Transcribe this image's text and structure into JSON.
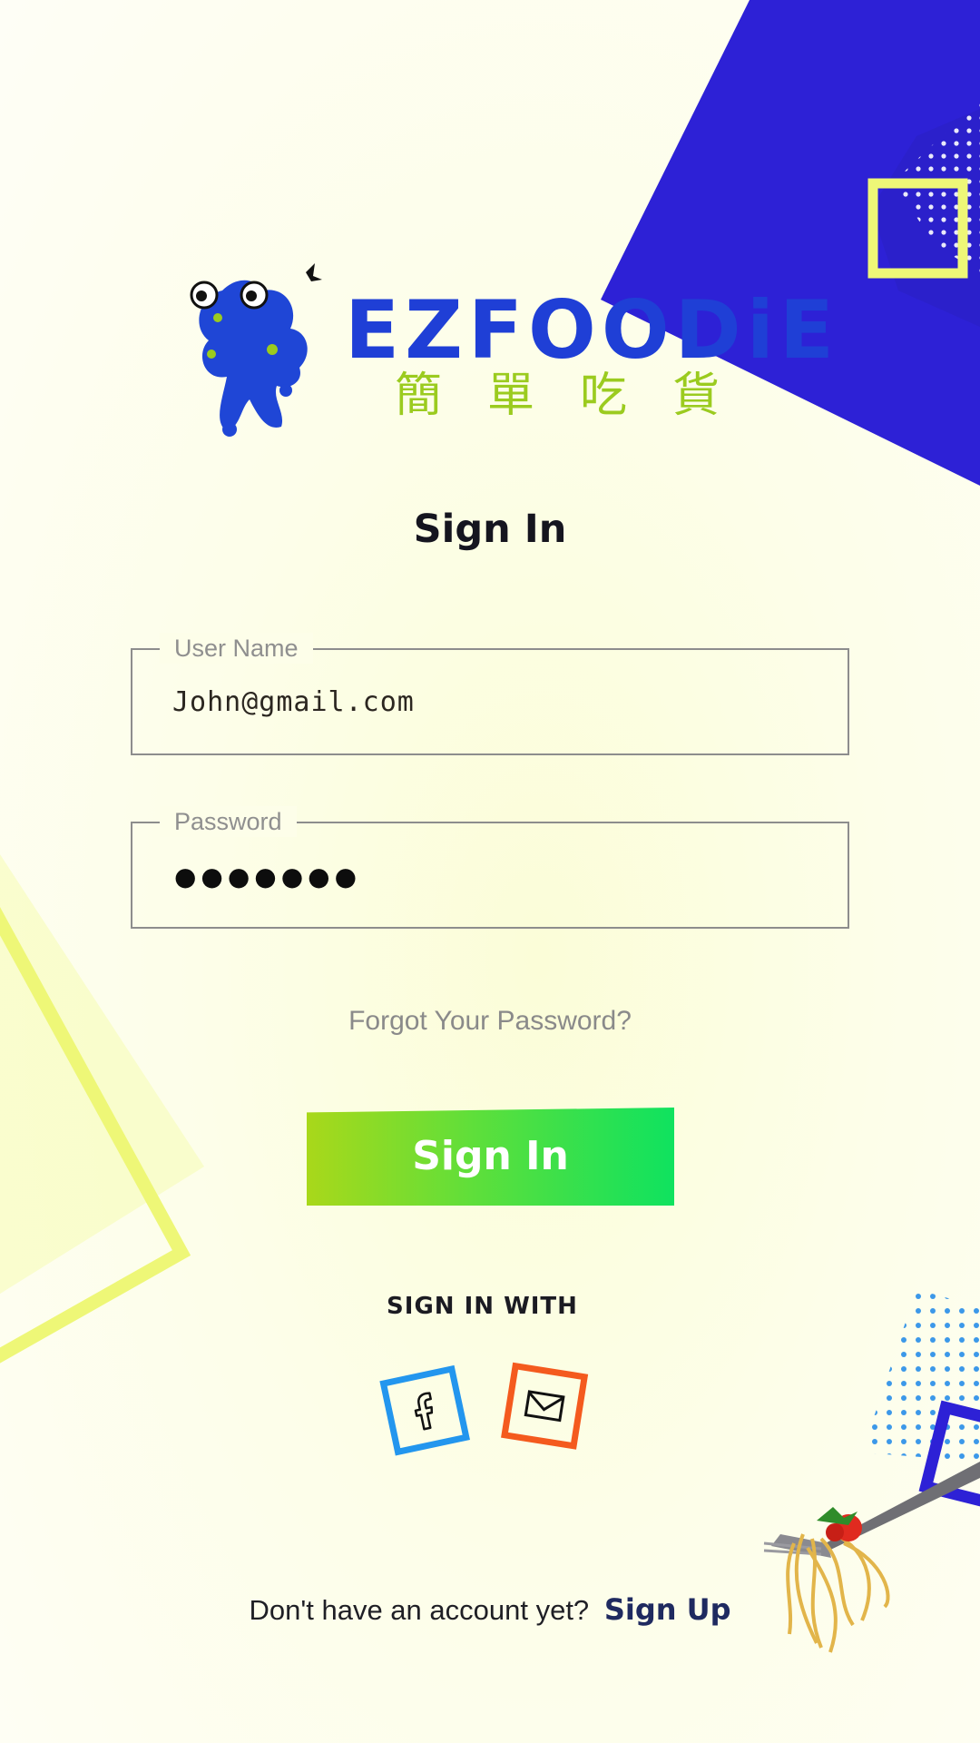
{
  "brand": {
    "logo_text": "EZFOODiE",
    "logo_subtitle": "簡單吃貨",
    "colors": {
      "primary_blue": "#2d21d6",
      "accent_green": "#9bcb1f",
      "button_start": "#a9d81a",
      "button_end": "#0fe25f",
      "facebook": "#2396ee",
      "mail": "#f45a1e",
      "frame_yellow": "#eef777"
    }
  },
  "page": {
    "title": "Sign In"
  },
  "form": {
    "username": {
      "label": "User Name",
      "value": "John@gmail.com"
    },
    "password": {
      "label": "Password",
      "masked_value": "●●●●●●●"
    },
    "forgot_link": "Forgot Your Password?",
    "submit_label": "Sign In"
  },
  "social": {
    "heading": "SIGN IN WITH",
    "providers": [
      {
        "name": "facebook",
        "icon": "facebook-icon"
      },
      {
        "name": "email",
        "icon": "mail-icon"
      }
    ]
  },
  "footer": {
    "prompt": "Don't have an account yet?",
    "signup_label": "Sign Up"
  }
}
